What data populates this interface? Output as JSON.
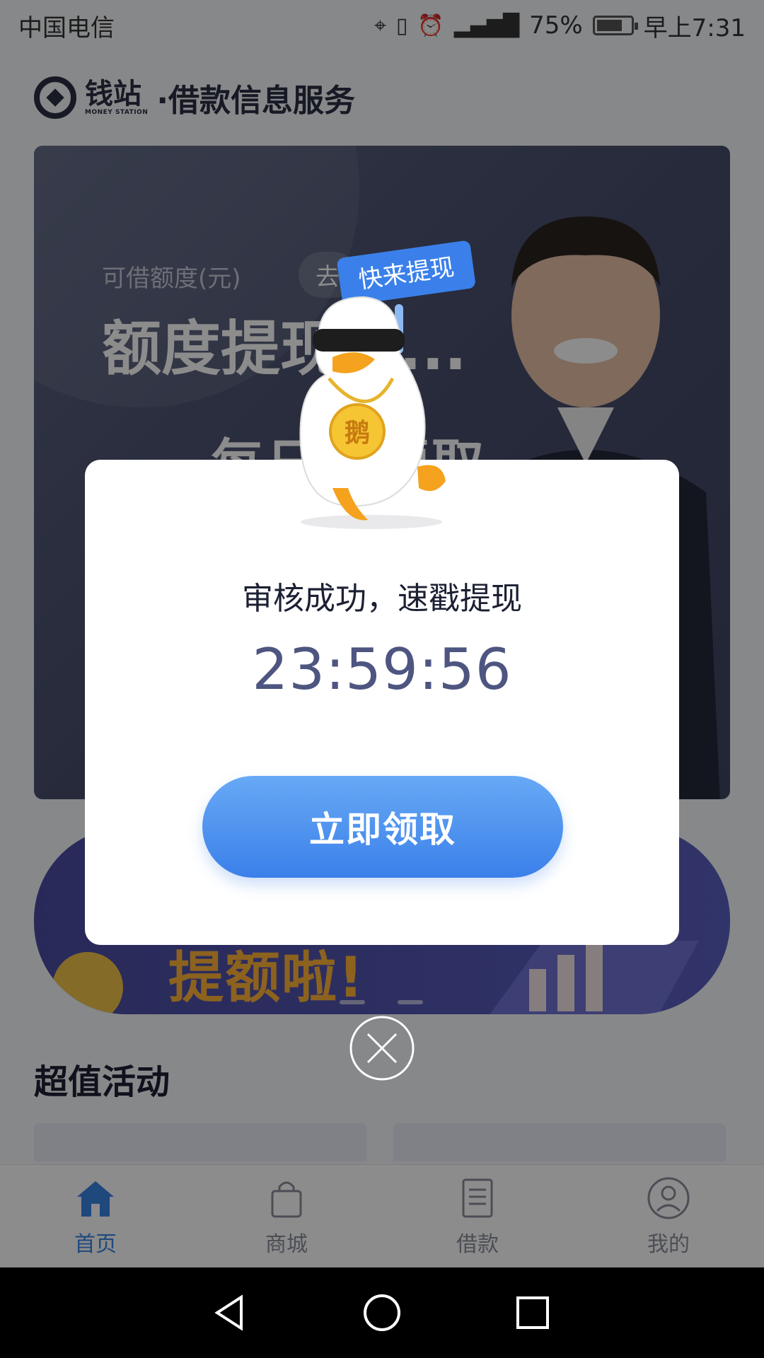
{
  "status_bar": {
    "carrier": "中国电信",
    "battery_percent": "75%",
    "battery_level": 0.75,
    "time": "早上7:31",
    "icons": [
      "location-icon",
      "vibrate-icon",
      "alarm-icon",
      "signal-4g-icon",
      "battery-icon"
    ]
  },
  "header": {
    "logo_cn": "钱站",
    "logo_en": "MONEY STATION",
    "subtitle": "·借款信息服务"
  },
  "hero": {
    "credit_label": "可借额度(元)",
    "pill_label": "去",
    "credit_status": "额度提现中...",
    "slogan": "每日可领取"
  },
  "banner": {
    "text": "提额啦!"
  },
  "section": {
    "title": "超值活动"
  },
  "tabs": [
    {
      "label": "首页",
      "icon": "home-icon",
      "active": true
    },
    {
      "label": "商城",
      "icon": "shopping-bag-icon",
      "active": false
    },
    {
      "label": "借款",
      "icon": "document-icon",
      "active": false
    },
    {
      "label": "我的",
      "icon": "profile-icon",
      "active": false
    }
  ],
  "modal": {
    "sign_text": "快来提现",
    "medal_text": "鹅",
    "title": "审核成功，速戳提现",
    "timer": "23:59:56",
    "button_label": "立即领取"
  },
  "colors": {
    "accent": "#3b80ea",
    "active_tab": "#3a84e4",
    "timer": "#4d5580",
    "banner_text": "#ffb23a"
  }
}
